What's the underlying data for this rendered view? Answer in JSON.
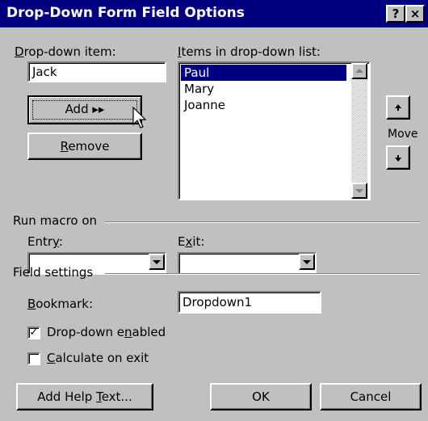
{
  "window": {
    "title": "Drop-Down Form Field Options",
    "help_btn": "?",
    "close_btn": "×"
  },
  "dropdown_item": {
    "label": "Drop-down item:",
    "value": "Jack"
  },
  "items_list": {
    "label": "Items in drop-down list:",
    "items": [
      "Paul",
      "Mary",
      "Joanne"
    ],
    "selected_index": 0
  },
  "buttons": {
    "add": "Add ▸▸",
    "remove": "Remove",
    "move": "Move",
    "add_help_text": "Add Help Text...",
    "ok": "OK",
    "cancel": "Cancel"
  },
  "run_macro": {
    "label": "Run macro on",
    "entry_label": "Entry:",
    "entry_value": "",
    "exit_label": "Exit:",
    "exit_value": ""
  },
  "field_settings": {
    "label": "Field settings",
    "bookmark_label": "Bookmark:",
    "bookmark_value": "Dropdown1",
    "dropdown_enabled": {
      "label": "Drop-down enabled",
      "checked": true
    },
    "calculate_on_exit": {
      "label": "Calculate on exit",
      "checked": false
    }
  },
  "icons": {
    "move_up": "arrow-up-icon",
    "move_down": "arrow-down-icon",
    "cursor": "mouse-pointer-icon"
  }
}
